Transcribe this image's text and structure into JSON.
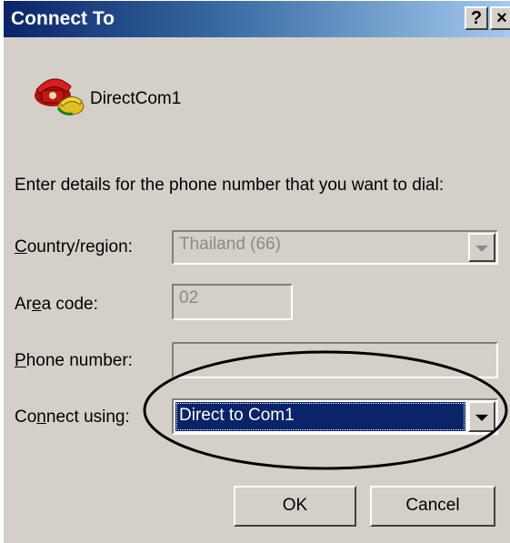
{
  "window": {
    "title": "Connect To",
    "help_label": "?",
    "close_label": "×"
  },
  "connection": {
    "name": "DirectCom1",
    "icon": "phone-connection-icon"
  },
  "instructions": "Enter details for the phone number that you want to dial:",
  "form": {
    "country": {
      "label": "Country/region:",
      "mnemonic": "C",
      "value": "Thailand (66)",
      "disabled": true
    },
    "area_code": {
      "label": "Area code:",
      "mnemonic": "e",
      "value": "02",
      "disabled": true
    },
    "phone_number": {
      "label": "Phone number:",
      "mnemonic": "P",
      "value": "",
      "disabled": true
    },
    "connect_using": {
      "label": "Connect using:",
      "mnemonic": "n",
      "value": "Direct to Com1",
      "disabled": false
    }
  },
  "buttons": {
    "ok": "OK",
    "cancel": "Cancel"
  },
  "annotation": {
    "shape": "ellipse",
    "color": "#000000",
    "target": "connect_using"
  },
  "colors": {
    "title_start": "#0a246a",
    "title_end": "#a6caf0",
    "dialog_bg": "#d4d0c8",
    "selection": "#0a246a"
  }
}
